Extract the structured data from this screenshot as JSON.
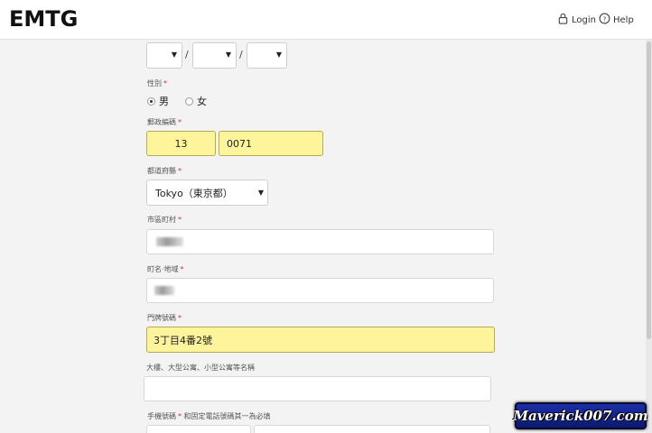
{
  "header": {
    "logo": "EMTG",
    "login_label": "Login",
    "help_label": "Help"
  },
  "birthdate": {
    "separator1": "/",
    "separator2": "/"
  },
  "gender": {
    "label": "性別",
    "required": "*",
    "options": [
      {
        "label": "男",
        "selected": true
      },
      {
        "label": "女",
        "selected": false
      }
    ]
  },
  "postal": {
    "label": "郵政編碼",
    "required": "*",
    "part1": "13",
    "part2": "0071"
  },
  "prefecture": {
    "label": "都道府縣",
    "required": "*",
    "value": "Tokyo（東京都）"
  },
  "city": {
    "label": "市區町村",
    "required": "*"
  },
  "town": {
    "label": "町名·地域",
    "required": "*"
  },
  "address_number": {
    "label": "門牌號碼",
    "required": "*",
    "value": "3丁目4番2號"
  },
  "building": {
    "label": "大樓、大型公寓、小型公寓等名稱"
  },
  "phone": {
    "label": "手機號碼",
    "required": "*",
    "note": "和固定電話號碼其一為必填"
  },
  "watermark": "Maverick007.com",
  "colors": {
    "highlight": "#fdf49c",
    "required": "#cc3333"
  }
}
